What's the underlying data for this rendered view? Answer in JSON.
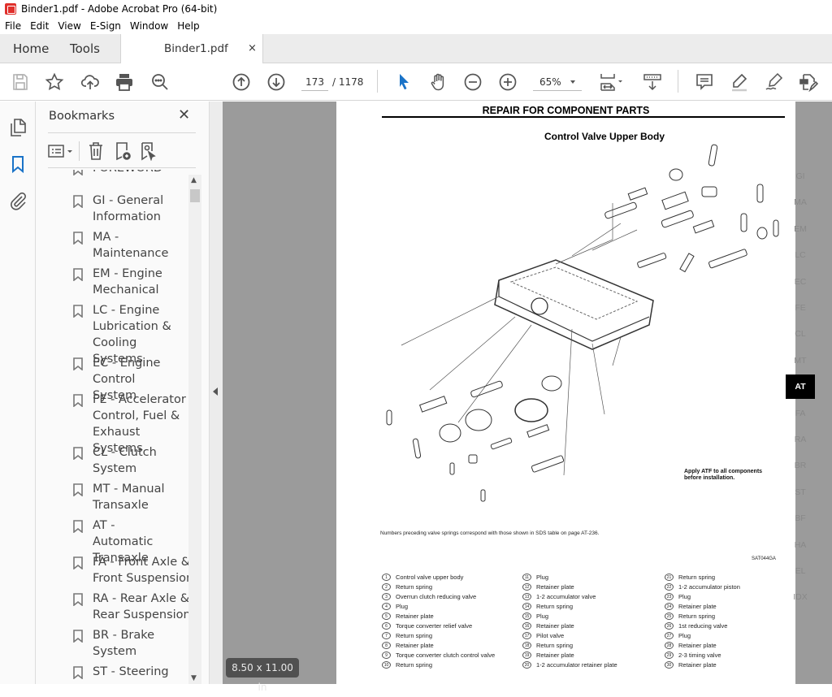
{
  "window": {
    "title": "Binder1.pdf - Adobe Acrobat Pro (64-bit)"
  },
  "menu": [
    "File",
    "Edit",
    "View",
    "E-Sign",
    "Window",
    "Help"
  ],
  "tabs": {
    "home": "Home",
    "tools": "Tools",
    "document": "Binder1.pdf",
    "close": "×"
  },
  "toolbar": {
    "icons": [
      "save-icon",
      "bookmark-star-icon",
      "upload-cloud-icon",
      "print-icon",
      "search-zoom-icon",
      "page-up-icon",
      "page-down-icon",
      "select-cursor-icon",
      "hand-icon",
      "zoom-out-icon",
      "zoom-in-icon",
      "fit-page-icon",
      "scroll-mode-icon",
      "comment-icon",
      "highlight-icon",
      "sign-icon",
      "edit-pdf-icon"
    ],
    "current_page": "173",
    "total_pages": "/ 1178",
    "zoom": "65%"
  },
  "left_rail": [
    "pages-icon",
    "bookmarks-icon",
    "attachments-icon"
  ],
  "bookmarks": {
    "title": "Bookmarks",
    "close": "✕",
    "items": [
      "FOREWORD",
      "GI - General Information",
      "MA - Maintenance",
      "EM - Engine Mechanical",
      "LC - Engine Lubrication & Cooling Systems",
      "EC - Engine Control System",
      "FE - Accelerator Control, Fuel & Exhaust Systems",
      "CL - Clutch System",
      "MT - Manual Transaxle",
      "AT - Automatic Transaxle",
      "FA - Front Axle & Front Suspension",
      "RA - Rear Axle & Rear Suspension",
      "BR - Brake System",
      "ST - Steering"
    ]
  },
  "page_size": "8.50 x 11.00 in",
  "document": {
    "header": "REPAIR FOR COMPONENT PARTS",
    "subtitle": "Control Valve Upper Body",
    "side_tabs": [
      "GI",
      "MA",
      "EM",
      "LC",
      "EC",
      "FE",
      "CL",
      "MT",
      "AT",
      "FA",
      "RA",
      "BR",
      "ST",
      "BF",
      "HA",
      "EL",
      "IDX"
    ],
    "active_side_tab": "AT",
    "apply_note": "Apply ATF to all components before installation.",
    "springs_note": "Numbers preceding valve springs correspond with those shown in SDS table on page AT-236.",
    "figure_code": "SAT044GA",
    "legend": [
      {
        "n": "1",
        "t": "Control valve upper body"
      },
      {
        "n": "2",
        "t": "Return spring"
      },
      {
        "n": "3",
        "t": "Overrun clutch reducing valve"
      },
      {
        "n": "4",
        "t": "Plug"
      },
      {
        "n": "5",
        "t": "Retainer plate"
      },
      {
        "n": "6",
        "t": "Torque converter relief valve"
      },
      {
        "n": "7",
        "t": "Return spring"
      },
      {
        "n": "8",
        "t": "Retainer plate"
      },
      {
        "n": "9",
        "t": "Torque converter clutch control valve"
      },
      {
        "n": "10",
        "t": "Return spring"
      },
      {
        "n": "11",
        "t": "Plug"
      },
      {
        "n": "12",
        "t": "Retainer plate"
      },
      {
        "n": "13",
        "t": "1-2 accumulator valve"
      },
      {
        "n": "14",
        "t": "Return spring"
      },
      {
        "n": "15",
        "t": "Plug"
      },
      {
        "n": "16",
        "t": "Retainer plate"
      },
      {
        "n": "17",
        "t": "Pilot valve"
      },
      {
        "n": "18",
        "t": "Return spring"
      },
      {
        "n": "19",
        "t": "Retainer plate"
      },
      {
        "n": "20",
        "t": "1-2 accumulator retainer plate"
      },
      {
        "n": "21",
        "t": "Return spring"
      },
      {
        "n": "22",
        "t": "1-2 accumulator piston"
      },
      {
        "n": "23",
        "t": "Plug"
      },
      {
        "n": "24",
        "t": "Retainer plate"
      },
      {
        "n": "25",
        "t": "Return spring"
      },
      {
        "n": "26",
        "t": "1st reducing valve"
      },
      {
        "n": "27",
        "t": "Plug"
      },
      {
        "n": "28",
        "t": "Retainer plate"
      },
      {
        "n": "29",
        "t": "2-3 timing valve"
      },
      {
        "n": "30",
        "t": "Retainer plate"
      }
    ]
  }
}
